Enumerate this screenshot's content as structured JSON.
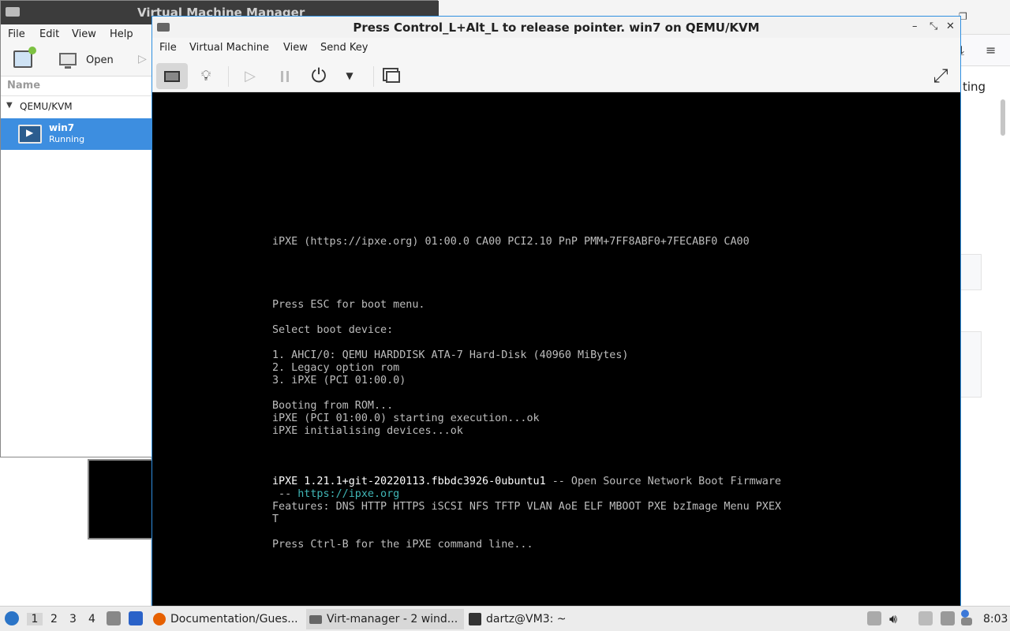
{
  "colors": {
    "accent": "#3d8ee0",
    "console_border": "#2f8fe0",
    "terminal_link": "#40b6b6"
  },
  "background_browser": {
    "page_fragment": "ting"
  },
  "vmm": {
    "title": "Virtual Machine Manager",
    "menu": [
      "File",
      "Edit",
      "View",
      "Help"
    ],
    "toolbar": {
      "open_label": "Open"
    },
    "list_header": "Name",
    "group": "QEMU/KVM",
    "vm": {
      "name": "win7",
      "status": "Running"
    }
  },
  "console": {
    "title": "Press Control_L+Alt_L to release pointer. win7 on QEMU/KVM",
    "menu": [
      "File",
      "Virtual Machine",
      "View",
      "Send Key"
    ],
    "toolbar_icons": [
      "monitor-icon",
      "lightbulb-icon",
      "play-icon",
      "pause-icon",
      "power-icon",
      "chevron-down-icon",
      "screenshot-icon",
      "fullscreen-icon"
    ],
    "screen": {
      "line_ipxe_header": "iPXE (https://ipxe.org) 01:00.0 CA00 PCI2.10 PnP PMM+7FF8ABF0+7FECABF0 CA00",
      "line_esc": "Press ESC for boot menu.",
      "line_select": "Select boot device:",
      "boot_options": [
        "1. AHCI/0: QEMU HARDDISK ATA-7 Hard-Disk (40960 MiBytes)",
        "2. Legacy option rom",
        "3. iPXE (PCI 01:00.0)"
      ],
      "boot_log": [
        "Booting from ROM...",
        "iPXE (PCI 01:00.0) starting execution...ok",
        "iPXE initialising devices...ok"
      ],
      "version_line": "iPXE 1.21.1+git-20220113.fbbdc3926-0ubuntu1",
      "version_suffix": " -- Open Source Network Boot Firmware",
      "link_prefix": " -- ",
      "link": "https://ipxe.org",
      "features_line1": "Features: DNS HTTP HTTPS iSCSI NFS TFTP VLAN AoE ELF MBOOT PXE bzImage Menu PXEX",
      "features_line2": "T",
      "ctrl_b": "Press Ctrl-B for the iPXE command line..."
    }
  },
  "taskbar": {
    "workspaces": [
      "1",
      "2",
      "3",
      "4"
    ],
    "tasks": [
      "Documentation/Gues...",
      "Virt-manager - 2 wind...",
      "dartz@VM3: ~"
    ],
    "clock": "8:03"
  }
}
